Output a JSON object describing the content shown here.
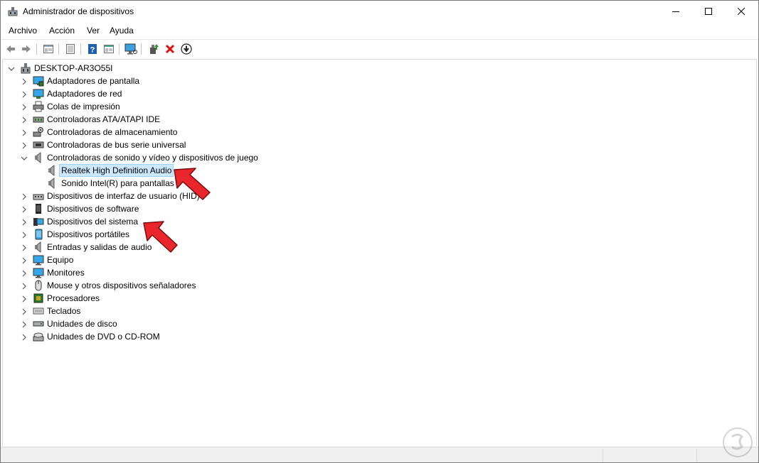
{
  "window": {
    "title": "Administrador de dispositivos"
  },
  "menubar": {
    "items": [
      "Archivo",
      "Acción",
      "Ver",
      "Ayuda"
    ]
  },
  "toolbar": {
    "buttons": [
      "back-icon",
      "forward-icon",
      "properties-view-icon",
      "list-icon",
      "help-icon",
      "show-icon",
      "scan-hardware-icon",
      "update-driver-icon",
      "uninstall-icon",
      "download-icon"
    ]
  },
  "tree": {
    "root": "DESKTOP-AR3O55I",
    "items": [
      {
        "label": "Adaptadores de pantalla",
        "icon": "display-adapter-icon",
        "expanded": false
      },
      {
        "label": "Adaptadores de red",
        "icon": "network-adapter-icon",
        "expanded": false
      },
      {
        "label": "Colas de impresión",
        "icon": "print-queue-icon",
        "expanded": false
      },
      {
        "label": "Controladoras ATA/ATAPI IDE",
        "icon": "ide-controller-icon",
        "expanded": false
      },
      {
        "label": "Controladoras de almacenamiento",
        "icon": "storage-controller-icon",
        "expanded": false
      },
      {
        "label": "Controladoras de bus serie universal",
        "icon": "usb-controller-icon",
        "expanded": false
      },
      {
        "label": "Controladoras de sonido y vídeo y dispositivos de juego",
        "icon": "speaker-icon",
        "expanded": true
      },
      {
        "label": "Dispositivos de interfaz de usuario (HID)",
        "icon": "hid-icon",
        "expanded": false
      },
      {
        "label": "Dispositivos de software",
        "icon": "software-device-icon",
        "expanded": false
      },
      {
        "label": "Dispositivos del sistema",
        "icon": "system-device-icon",
        "expanded": false
      },
      {
        "label": "Dispositivos portátiles",
        "icon": "portable-device-icon",
        "expanded": false
      },
      {
        "label": "Entradas y salidas de audio",
        "icon": "speaker-icon",
        "expanded": false
      },
      {
        "label": "Equipo",
        "icon": "computer-icon",
        "expanded": false
      },
      {
        "label": "Monitores",
        "icon": "monitor-icon",
        "expanded": false
      },
      {
        "label": "Mouse y otros dispositivos señaladores",
        "icon": "mouse-icon",
        "expanded": false
      },
      {
        "label": "Procesadores",
        "icon": "processor-icon",
        "expanded": false
      },
      {
        "label": "Teclados",
        "icon": "keyboard-icon",
        "expanded": false
      },
      {
        "label": "Unidades de disco",
        "icon": "disk-drive-icon",
        "expanded": false
      },
      {
        "label": "Unidades de DVD o CD-ROM",
        "icon": "dvd-drive-icon",
        "expanded": false
      }
    ],
    "children": [
      {
        "label": "Realtek High Definition Audio",
        "icon": "speaker-icon",
        "selected": true
      },
      {
        "label": "Sonido Intel(R) para pantallas",
        "icon": "speaker-icon",
        "selected": false
      }
    ]
  },
  "colors": {
    "selection_bg": "#cce8ff",
    "selection_border": "#99d1ff",
    "arrow_red": "#e8262b",
    "uninstall_red": "#e01010"
  }
}
